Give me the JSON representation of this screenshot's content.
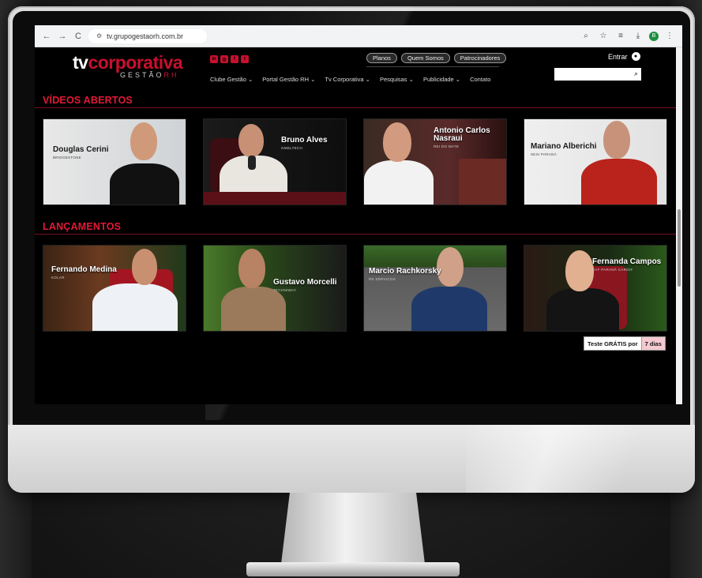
{
  "browser": {
    "url": "tv.grupogestaorh.com.br",
    "nav_back": "←",
    "nav_forward": "→",
    "nav_reload": "C",
    "account_initial": "B"
  },
  "header": {
    "logo_main_white": "tv",
    "logo_main_red": "corporativa",
    "logo_sub_white": "GESTÃO",
    "logo_sub_red": "RH",
    "socials": [
      "in",
      "◎",
      "f",
      "t"
    ],
    "pills": [
      "Planos",
      "Quem Somos",
      "Patrocinadores"
    ],
    "menu": [
      "Clube Gestão ⌄",
      "Portal Gestão RH ⌄",
      "Tv Corporativa ⌄",
      "Pesquisas ⌄",
      "Publicidade ⌄",
      "Contato"
    ],
    "login_label": "Entrar"
  },
  "sections": {
    "open_videos_title": "VÍDEOS ABERTOS",
    "releases_title": "LANÇAMENTOS"
  },
  "open_videos": [
    {
      "name": "Douglas Cerini",
      "company": "BRIDGESTONE"
    },
    {
      "name": "Bruno Alves",
      "company": "GMELTECH"
    },
    {
      "name": "Antonio Carlos Nasraui",
      "company": "REI DO MATE"
    },
    {
      "name": "Mariano Alberichi",
      "company": "SESI PARANÁ"
    }
  ],
  "releases": [
    {
      "name": "Fernando Medina",
      "company": "KOLAR"
    },
    {
      "name": "Gustavo Morcelli",
      "company": "TECHNIWAY"
    },
    {
      "name": "Marcio Rachkorsky",
      "company": "RS SERVICOS"
    },
    {
      "name": "Fernanda Campos",
      "company": "EAF PARANÁ CARGIF"
    }
  ],
  "trial": {
    "label": "Teste GRÁTIS por",
    "days": "7 dias"
  },
  "colors": {
    "brand_red": "#c8102e",
    "background": "#000000"
  }
}
